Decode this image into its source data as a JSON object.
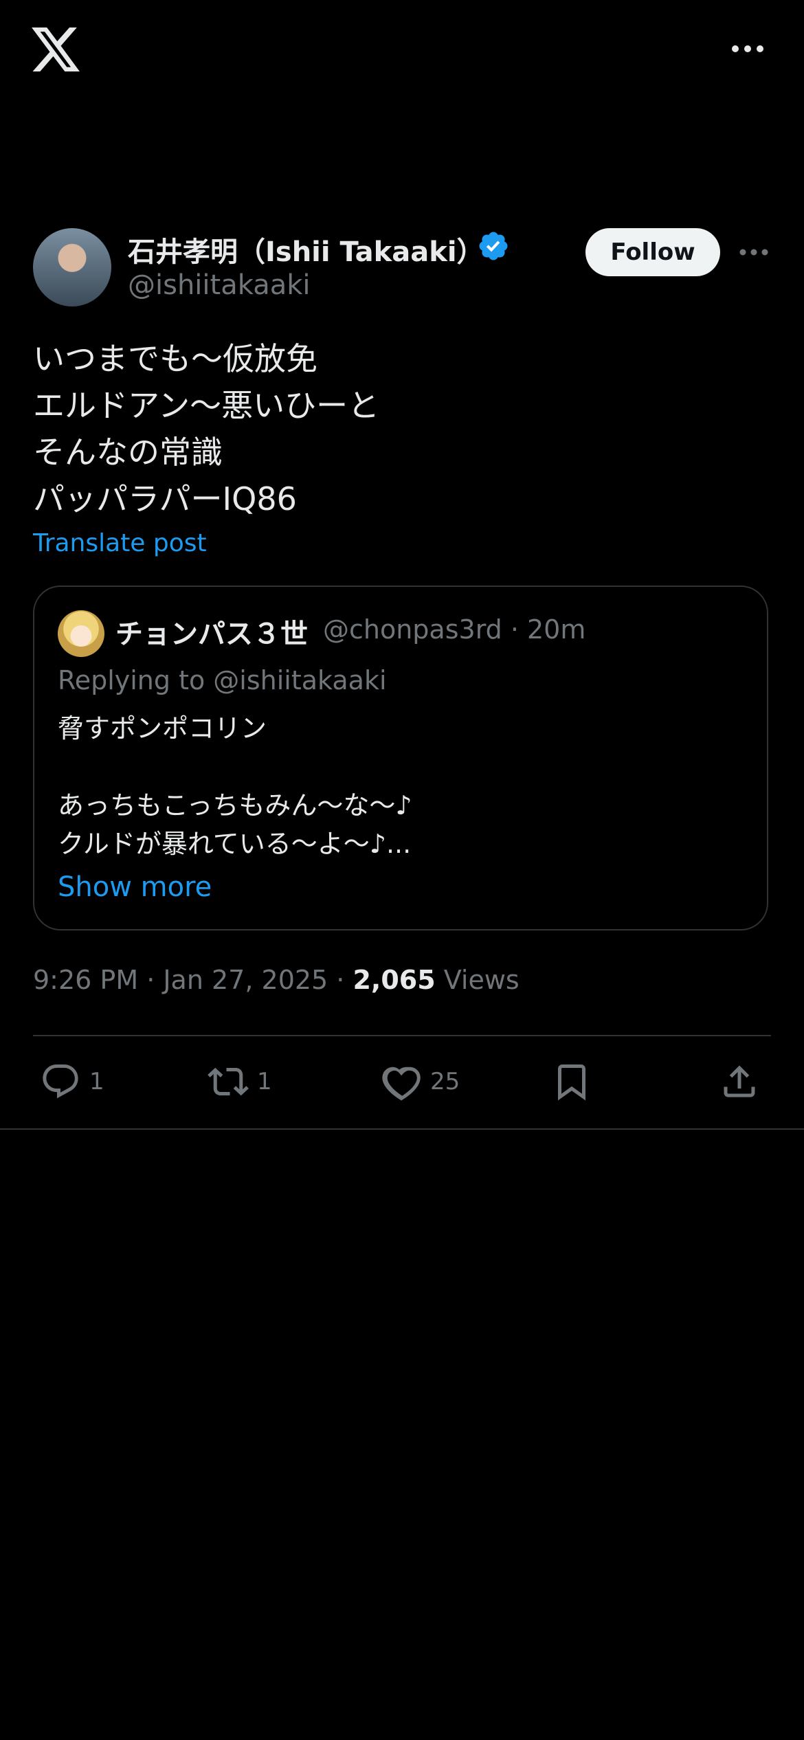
{
  "author": {
    "name": "石井孝明（Ishii Takaaki）",
    "handle": "@ishiitakaaki",
    "follow_label": "Follow"
  },
  "tweet": {
    "lines": [
      "いつまでも〜仮放免",
      "エルドアン〜悪いひーと",
      "そんなの常識",
      "パッパラパーIQ86"
    ],
    "translate_label": "Translate post"
  },
  "quote": {
    "name": "チョンパス３世",
    "meta": "@chonpas3rd · 20m",
    "replying_to": "Replying to @ishiitakaaki",
    "lines": [
      "脅すポンポコリン",
      "",
      "あっちもこっちもみん〜な〜♪",
      "クルドが暴れている〜よ〜♪..."
    ],
    "show_more_label": "Show more"
  },
  "meta": {
    "timestamp": "9:26 PM · Jan 27, 2025 · ",
    "views_count": "2,065",
    "views_label": " Views"
  },
  "actions": {
    "reply_count": "1",
    "retweet_count": "1",
    "like_count": "25"
  },
  "colors": {
    "background": "#000000",
    "accent": "#1d9bf0",
    "text_primary": "#e7e9ea",
    "text_secondary": "#71767b",
    "border": "#2f3336"
  },
  "icons": [
    "x-logo-icon",
    "more-icon",
    "verified-badge-icon",
    "reply-icon",
    "retweet-icon",
    "like-icon",
    "bookmark-icon",
    "share-icon"
  ]
}
